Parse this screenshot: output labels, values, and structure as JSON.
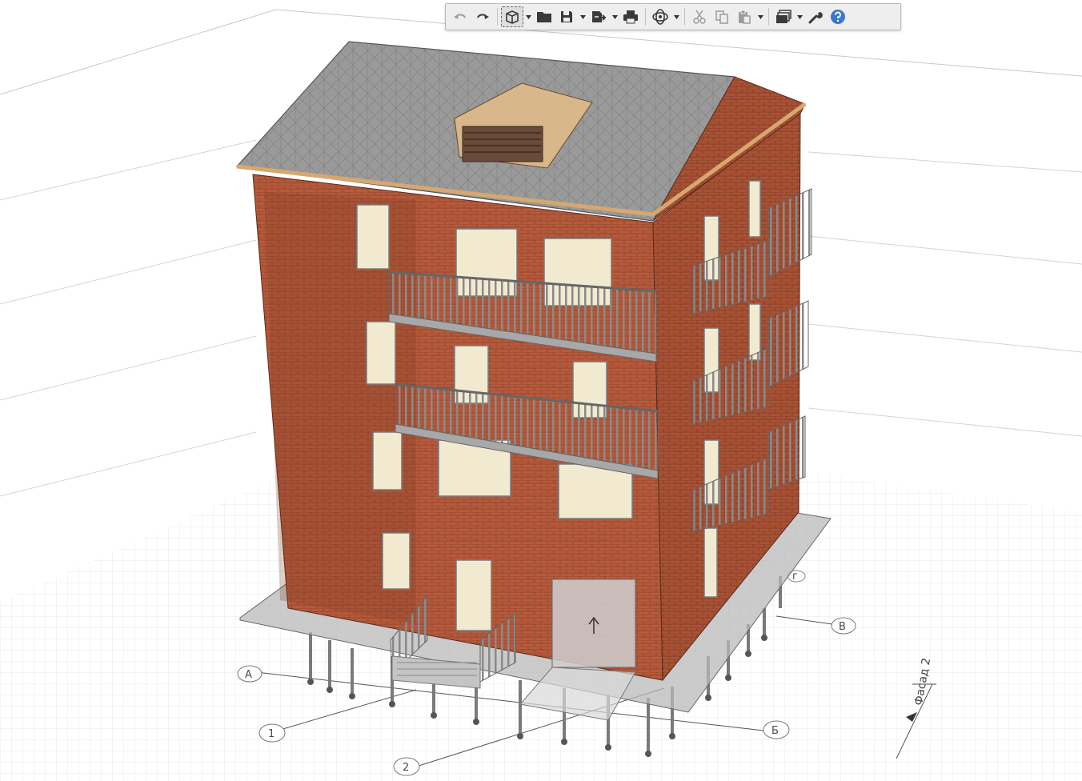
{
  "toolbar": {
    "buttons": [
      {
        "name": "undo-button",
        "icon": "undo-icon",
        "enabled": false
      },
      {
        "name": "redo-button",
        "icon": "redo-icon",
        "enabled": true
      },
      {
        "name": "view-3d-button",
        "icon": "cube-icon",
        "active": true,
        "dropdown": true
      },
      {
        "name": "open-button",
        "icon": "folder-icon"
      },
      {
        "name": "save-button",
        "icon": "save-icon",
        "dropdown": true
      },
      {
        "name": "export-button",
        "icon": "export-icon",
        "dropdown": true
      },
      {
        "name": "print-button",
        "icon": "printer-icon"
      },
      {
        "name": "orbit-button",
        "icon": "orbit-icon",
        "dropdown": true
      },
      {
        "name": "cut-button",
        "icon": "scissors-icon",
        "enabled": false
      },
      {
        "name": "copy-button",
        "icon": "copy-icon",
        "enabled": false
      },
      {
        "name": "paste-button",
        "icon": "paste-icon",
        "enabled": false,
        "dropdown": true
      },
      {
        "name": "layers-button",
        "icon": "layers-icon",
        "dropdown": true
      },
      {
        "name": "settings-button",
        "icon": "wrench-icon"
      },
      {
        "name": "help-button",
        "icon": "help-icon"
      }
    ]
  },
  "grid_axes": {
    "numbered": [
      "1",
      "2"
    ],
    "lettered": [
      "А",
      "Б",
      "В"
    ],
    "floor_marker": "г"
  },
  "facade_label": "Фасад 2",
  "colors": {
    "brick": "#b55a3c",
    "brick_dark": "#8f4128",
    "roof": "#8c8c8c",
    "railing": "#9a9a9a",
    "slab": "#bdbdbd",
    "window_glass": "#f2ead0",
    "grid": "#d6d6d6",
    "toolbar_bg": "#eeeeee",
    "icon": "#3a3a3a",
    "help_blue": "#3b78c8"
  }
}
